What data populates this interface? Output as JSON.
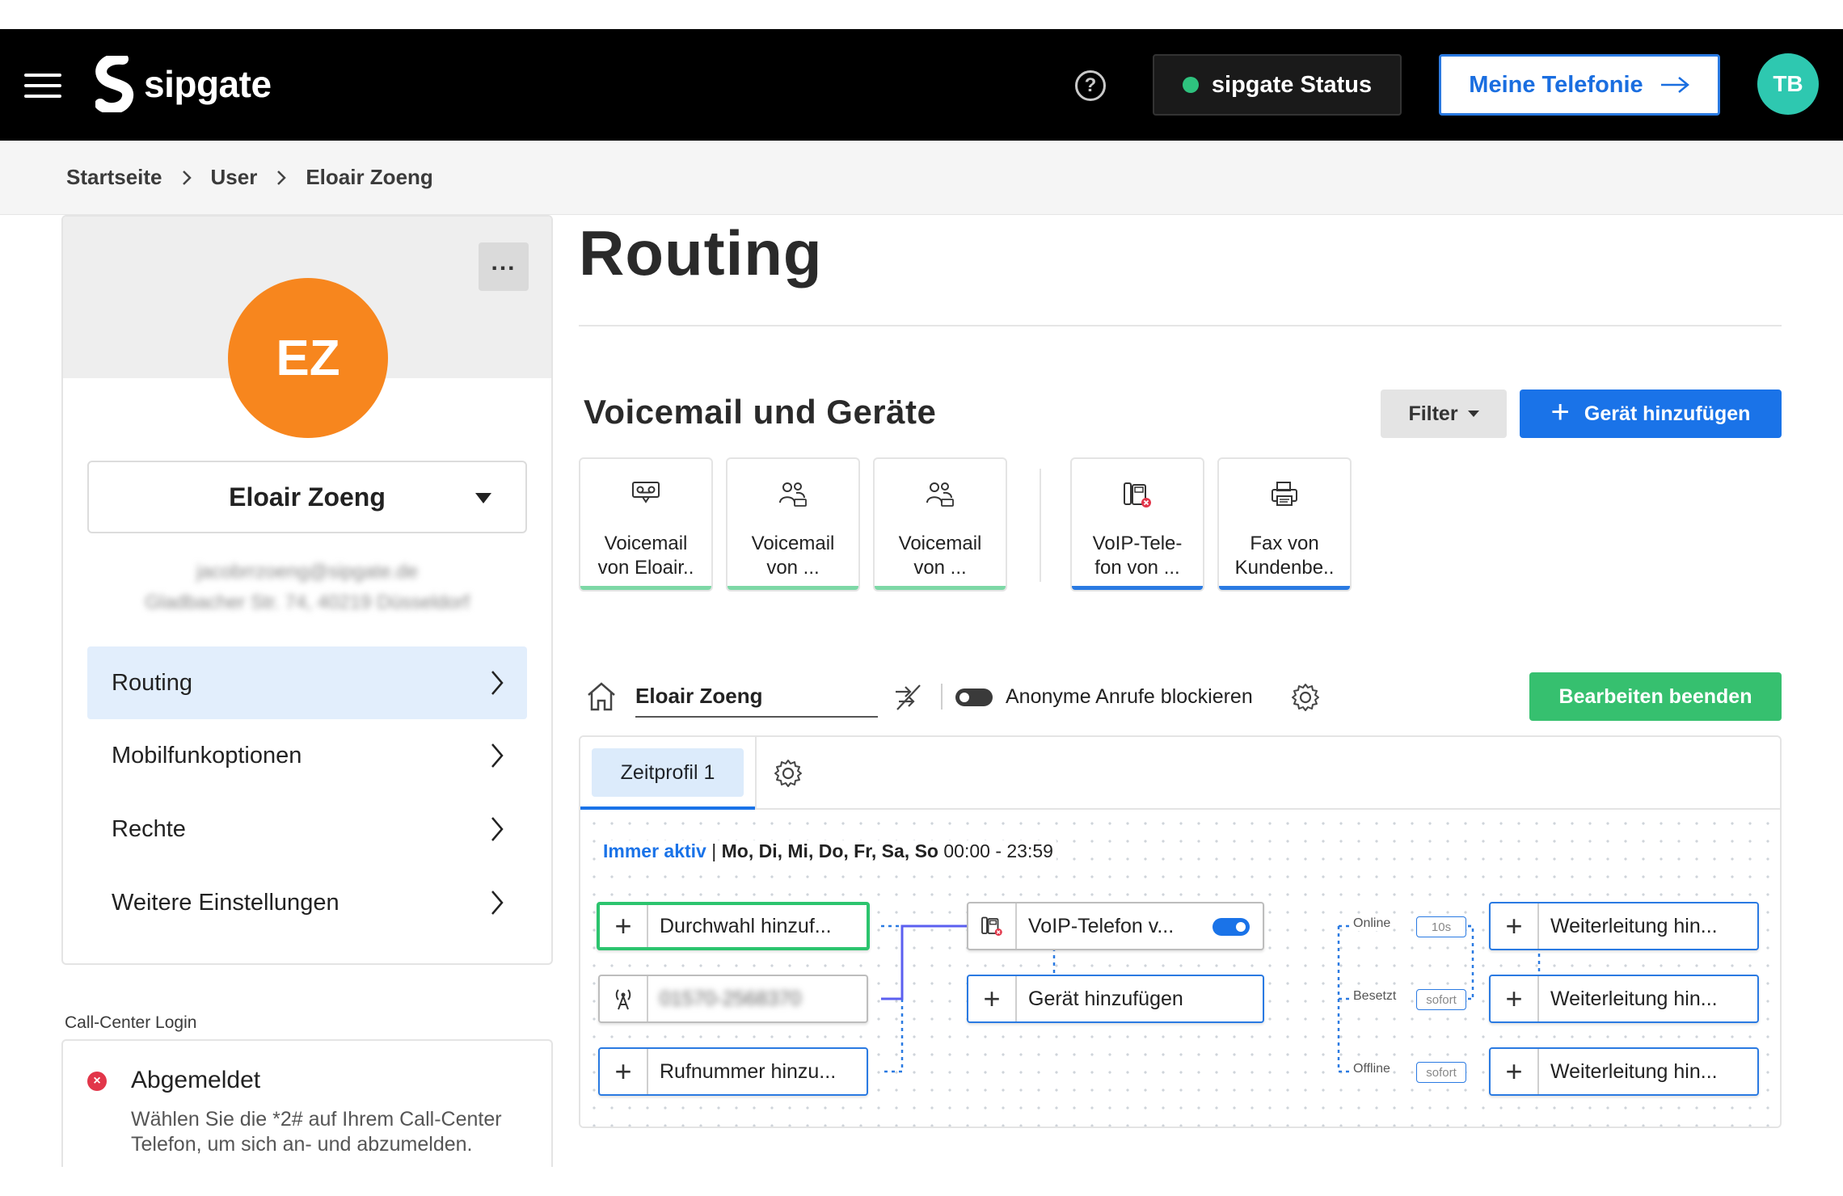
{
  "header": {
    "brand": "sipgate",
    "status_label": "sipgate Status",
    "status_color": "#2ec27e",
    "telefonie_label": "Meine Telefonie",
    "user_initials": "TB"
  },
  "breadcrumb": [
    "Startseite",
    "User",
    "Eloair Zoeng"
  ],
  "profile": {
    "initials": "EZ",
    "avatar_color": "#f7861e",
    "name": "Eloair Zoeng",
    "email": "jacobrrzoeng@sipgate.de",
    "address": "Gladbacher Str. 74, 40219 Düsseldorf"
  },
  "side_menu": [
    {
      "label": "Routing",
      "active": true
    },
    {
      "label": "Mobilfunkoptionen",
      "active": false
    },
    {
      "label": "Rechte",
      "active": false
    },
    {
      "label": "Weitere Einstellungen",
      "active": false
    }
  ],
  "call_center": {
    "section_label": "Call-Center Login",
    "status": "Abgemeldet",
    "description": "Wählen Sie die *2# auf Ihrem Call-Center Telefon, um sich an- und abzumelden."
  },
  "page": {
    "title": "Routing",
    "section_title": "Voicemail und Geräte",
    "filter_label": "Filter",
    "add_device_label": "Gerät hinzufügen"
  },
  "devices": [
    {
      "line1": "Voicemail",
      "line2": "von Eloair..",
      "icon": "voicemail-icon",
      "bar": "#7dd8a6"
    },
    {
      "line1": "Voicemail",
      "line2": "von ...",
      "icon": "group-voicemail-icon",
      "bar": "#7dd8a6"
    },
    {
      "line1": "Voicemail",
      "line2": "von ...",
      "icon": "group-voicemail-icon",
      "bar": "#7dd8a6"
    },
    {
      "line1": "VoIP-Tele-",
      "line2": "fon von ...",
      "icon": "voip-phone-icon",
      "bar": "#2a7ae2"
    },
    {
      "line1": "Fax von",
      "line2": "Kundenbe..",
      "icon": "fax-icon",
      "bar": "#2a7ae2"
    }
  ],
  "toolbar": {
    "alias": "Eloair Zoeng",
    "anon_label": "Anonyme Anrufe blockieren",
    "end_edit_label": "Bearbeiten beenden"
  },
  "routing": {
    "tab_label": "Zeitprofil 1",
    "schedule_active": "Immer aktiv",
    "schedule_sep": " | ",
    "schedule_days": "Mo, Di, Mi, Do, Fr, Sa, So",
    "schedule_time": " 00:00 - 23:59",
    "nodes": {
      "durchwahl": "Durchwahl hinzuf...",
      "mobile_number": "01570-2568370",
      "rufnummer": "Rufnummer hinzu...",
      "voip": "VoIP-Telefon v...",
      "add_device": "Gerät hinzufügen",
      "forward_online": "Weiterleitung hin...",
      "forward_busy": "Weiterleitung hin...",
      "forward_offline": "Weiterleitung hin..."
    },
    "conditions": [
      {
        "label": "Online",
        "delay": "10s"
      },
      {
        "label": "Besetzt",
        "delay": "sofort"
      },
      {
        "label": "Offline",
        "delay": "sofort"
      }
    ]
  }
}
